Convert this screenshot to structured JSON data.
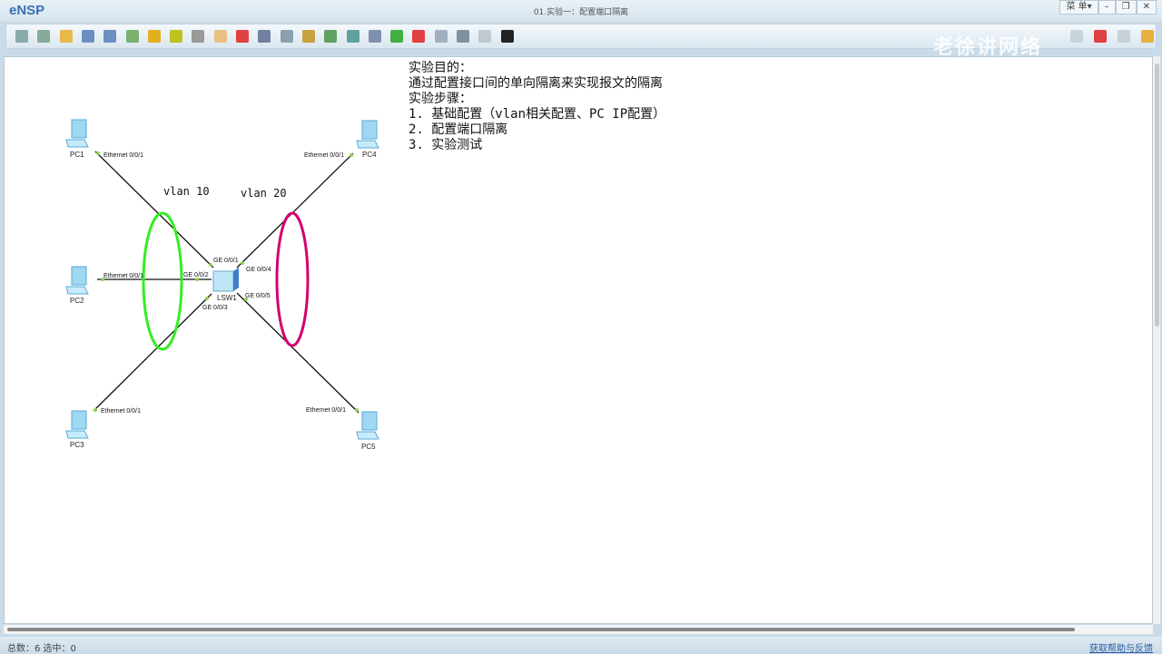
{
  "app": {
    "name": "eNSP",
    "title": "01.实验一：配置端口隔离"
  },
  "window_buttons": {
    "menu": "菜 单▾",
    "minimize": "–",
    "restore": "❐",
    "close": "✕"
  },
  "toolbar": [
    "new-topology",
    "new-page",
    "open",
    "save",
    "save-as",
    "print",
    "undo",
    "redo",
    "select",
    "pan",
    "delete",
    "delete-link",
    "text",
    "rectangle",
    "zoom-in",
    "zoom-out",
    "fit",
    "start",
    "stop",
    "capture",
    "topology-tree",
    "blank",
    "cli"
  ],
  "watermark": "老徐讲网络",
  "notes": [
    "实验目的：",
    "通过配置接口间的单向隔离来实现报文的隔离",
    "实验步骤：",
    "1. 基础配置（vlan相关配置、PC IP配置）",
    "2. 配置端口隔离",
    "3. 实验测试"
  ],
  "topology": {
    "switch": "LSW1",
    "pcs": [
      {
        "name": "PC1",
        "port": "Ethernet 0/0/1",
        "sw_port": "GE 0/0/1"
      },
      {
        "name": "PC2",
        "port": "Ethernet 0/0/1",
        "sw_port": "GE 0/0/2"
      },
      {
        "name": "PC3",
        "port": "Ethernet 0/0/1",
        "sw_port": "GE 0/0/3"
      },
      {
        "name": "PC4",
        "port": "Ethernet 0/0/1",
        "sw_port": "GE 0/0/4"
      },
      {
        "name": "PC5",
        "port": "Ethernet 0/0/1",
        "sw_port": "GE 0/0/5"
      }
    ],
    "vlans": [
      {
        "label": "vlan 10",
        "color": "#33ee22"
      },
      {
        "label": "vlan 20",
        "color": "#d4006e"
      }
    ]
  },
  "status": {
    "left": "总数：6 选中：0",
    "right": "获取帮助与反馈"
  }
}
